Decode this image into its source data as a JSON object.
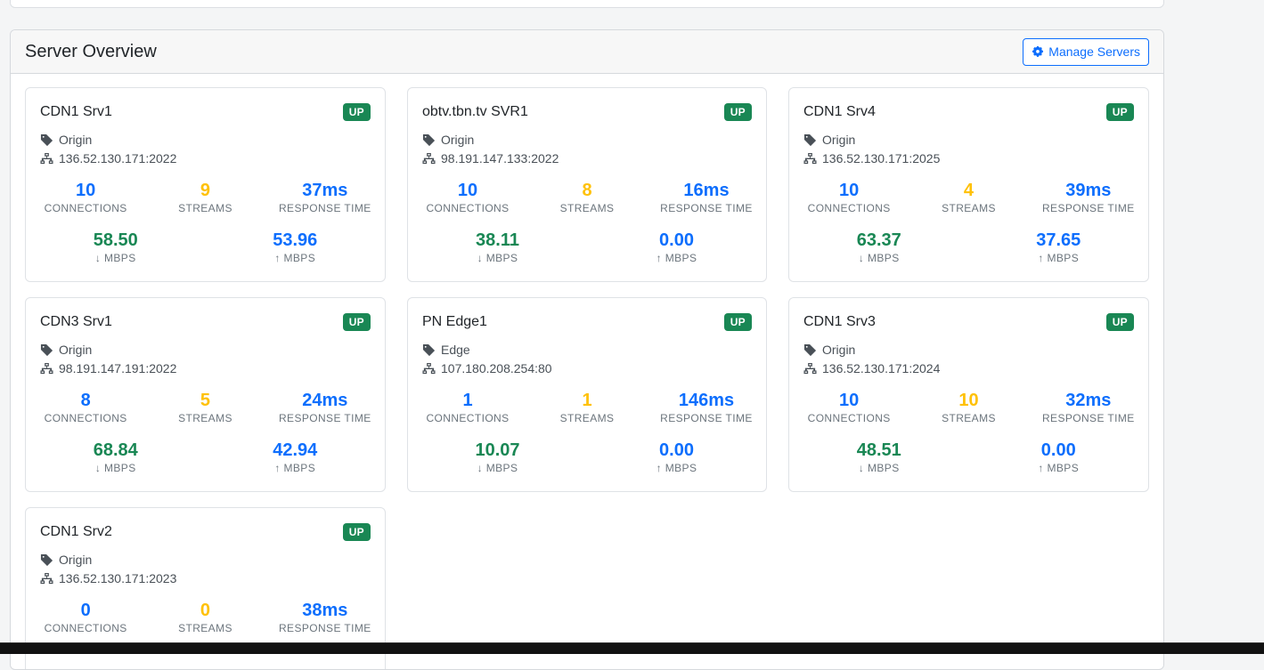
{
  "panel": {
    "title": "Server Overview",
    "manage_button_label": "Manage Servers"
  },
  "labels": {
    "connections": "CONNECTIONS",
    "streams": "STREAMS",
    "response_time": "RESPONSE TIME",
    "down": "↓ MBPS",
    "up": "↑ MBPS"
  },
  "colors": {
    "accent": "#0d6efd",
    "status_up": "#198754",
    "streams": "#ffc107"
  },
  "servers": [
    {
      "name": "CDN1 Srv1",
      "status": "UP",
      "type": "Origin",
      "address": "136.52.130.171:2022",
      "connections": "10",
      "streams": "9",
      "response_time": "37ms",
      "down_mbps": "58.50",
      "up_mbps": "53.96"
    },
    {
      "name": "obtv.tbn.tv SVR1",
      "status": "UP",
      "type": "Origin",
      "address": "98.191.147.133:2022",
      "connections": "10",
      "streams": "8",
      "response_time": "16ms",
      "down_mbps": "38.11",
      "up_mbps": "0.00"
    },
    {
      "name": "CDN1 Srv4",
      "status": "UP",
      "type": "Origin",
      "address": "136.52.130.171:2025",
      "connections": "10",
      "streams": "4",
      "response_time": "39ms",
      "down_mbps": "63.37",
      "up_mbps": "37.65"
    },
    {
      "name": "CDN3 Srv1",
      "status": "UP",
      "type": "Origin",
      "address": "98.191.147.191:2022",
      "connections": "8",
      "streams": "5",
      "response_time": "24ms",
      "down_mbps": "68.84",
      "up_mbps": "42.94"
    },
    {
      "name": "PN Edge1",
      "status": "UP",
      "type": "Edge",
      "address": "107.180.208.254:80",
      "connections": "1",
      "streams": "1",
      "response_time": "146ms",
      "down_mbps": "10.07",
      "up_mbps": "0.00"
    },
    {
      "name": "CDN1 Srv3",
      "status": "UP",
      "type": "Origin",
      "address": "136.52.130.171:2024",
      "connections": "10",
      "streams": "10",
      "response_time": "32ms",
      "down_mbps": "48.51",
      "up_mbps": "0.00"
    },
    {
      "name": "CDN1 Srv2",
      "status": "UP",
      "type": "Origin",
      "address": "136.52.130.171:2023",
      "connections": "0",
      "streams": "0",
      "response_time": "38ms"
    }
  ]
}
